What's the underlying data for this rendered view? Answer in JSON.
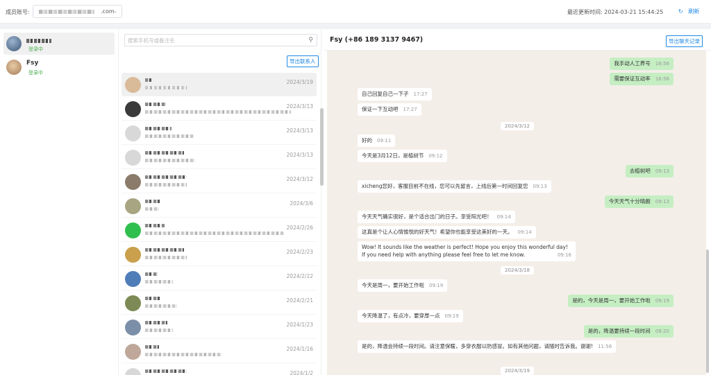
{
  "header": {
    "account_label": "成员账号:",
    "account_domain": ".com",
    "last_update": "最近更新时间: 2024-03-21 15:44:25",
    "refresh": "刷新"
  },
  "accounts": [
    {
      "name": "",
      "status": "登录中",
      "avatar": "#5a6e88"
    },
    {
      "name": "Fsy",
      "status": "登录中",
      "avatar": "#c9a07a"
    }
  ],
  "contacts": {
    "search_placeholder": "搜索手机号或备注名",
    "export_label": "导出联系人",
    "items": [
      {
        "date": "2024/3/19",
        "avatar": "#d9bb99"
      },
      {
        "date": "2024/3/13",
        "avatar": "#3a3a3a"
      },
      {
        "date": "2024/3/13",
        "avatar": "#d8d8d8"
      },
      {
        "date": "2024/3/13",
        "avatar": "#d8d8d8"
      },
      {
        "date": "2024/3/12",
        "avatar": "#8a7b6a"
      },
      {
        "date": "2024/3/6",
        "avatar": "#a7a582"
      },
      {
        "date": "2024/2/26",
        "avatar": "#2fbf4f"
      },
      {
        "date": "2024/2/23",
        "avatar": "#caa04d"
      },
      {
        "date": "2024/2/22",
        "avatar": "#4f7db8"
      },
      {
        "date": "2024/2/21",
        "avatar": "#7d8a55"
      },
      {
        "date": "2024/1/23",
        "avatar": "#7c8fa8"
      },
      {
        "date": "2024/1/16",
        "avatar": "#bfa89a"
      },
      {
        "date": "2024/1/2",
        "avatar": "#d8d8d8"
      }
    ]
  },
  "chat": {
    "title": "Fsy (+86 189 3137 9467)",
    "export_label": "导出聊天记录",
    "messages": [
      {
        "side": "r",
        "text": "我手动人工养号",
        "time": "16:56"
      },
      {
        "side": "r",
        "text": "需要保证互动率",
        "time": "16:56"
      },
      {
        "side": "l",
        "text": "自己回复自己一下子",
        "time": "17:27"
      },
      {
        "side": "l",
        "text": "保证一下互动吧",
        "time": "17:27"
      },
      {
        "side": "d",
        "text": "2024/3/12"
      },
      {
        "side": "l",
        "text": "好的",
        "time": "09:11"
      },
      {
        "side": "l",
        "text": "今天是3月12日，是植树节",
        "time": "09:12"
      },
      {
        "side": "r",
        "text": "去植树吧",
        "time": "09:13"
      },
      {
        "side": "l",
        "text": "xicheng您好，客服目前不在线，您可以先留言，上线后第一时间回复您",
        "time": "09:13"
      },
      {
        "side": "r",
        "text": "今天天气十分晴朗",
        "time": "09:13"
      },
      {
        "side": "l",
        "text": "今天天气确实很好，是个适合出门的日子。享受阳光吧！",
        "time": "09:14"
      },
      {
        "side": "l",
        "text": "这真是个让人心情愉悦的好天气！希望你也能享受这美好的一天。",
        "time": "09:14"
      },
      {
        "side": "l",
        "text": "Wow! It sounds like the weather is perfect! Hope you enjoy this wonderful day! If you need help with anything please feel free to let me know.",
        "time": "09:16"
      },
      {
        "side": "d",
        "text": "2024/3/18"
      },
      {
        "side": "l",
        "text": "今天是周一，要开始工作啦",
        "time": "09:19"
      },
      {
        "side": "r",
        "text": "是的，今天是周一，要开始工作啦",
        "time": "09:19"
      },
      {
        "side": "l",
        "text": "今天降温了，有点冷，要穿厚一点",
        "time": "09:19"
      },
      {
        "side": "r",
        "text": "是的，降温要持续一段时间",
        "time": "09:20"
      },
      {
        "side": "l",
        "text": "是的，降温会持续一段时间。请注意保暖，多穿衣服以防感冒。如有其他问题，请随时告诉我。谢谢!",
        "time": "11:56"
      },
      {
        "side": "d",
        "text": "2024/3/19"
      }
    ]
  }
}
